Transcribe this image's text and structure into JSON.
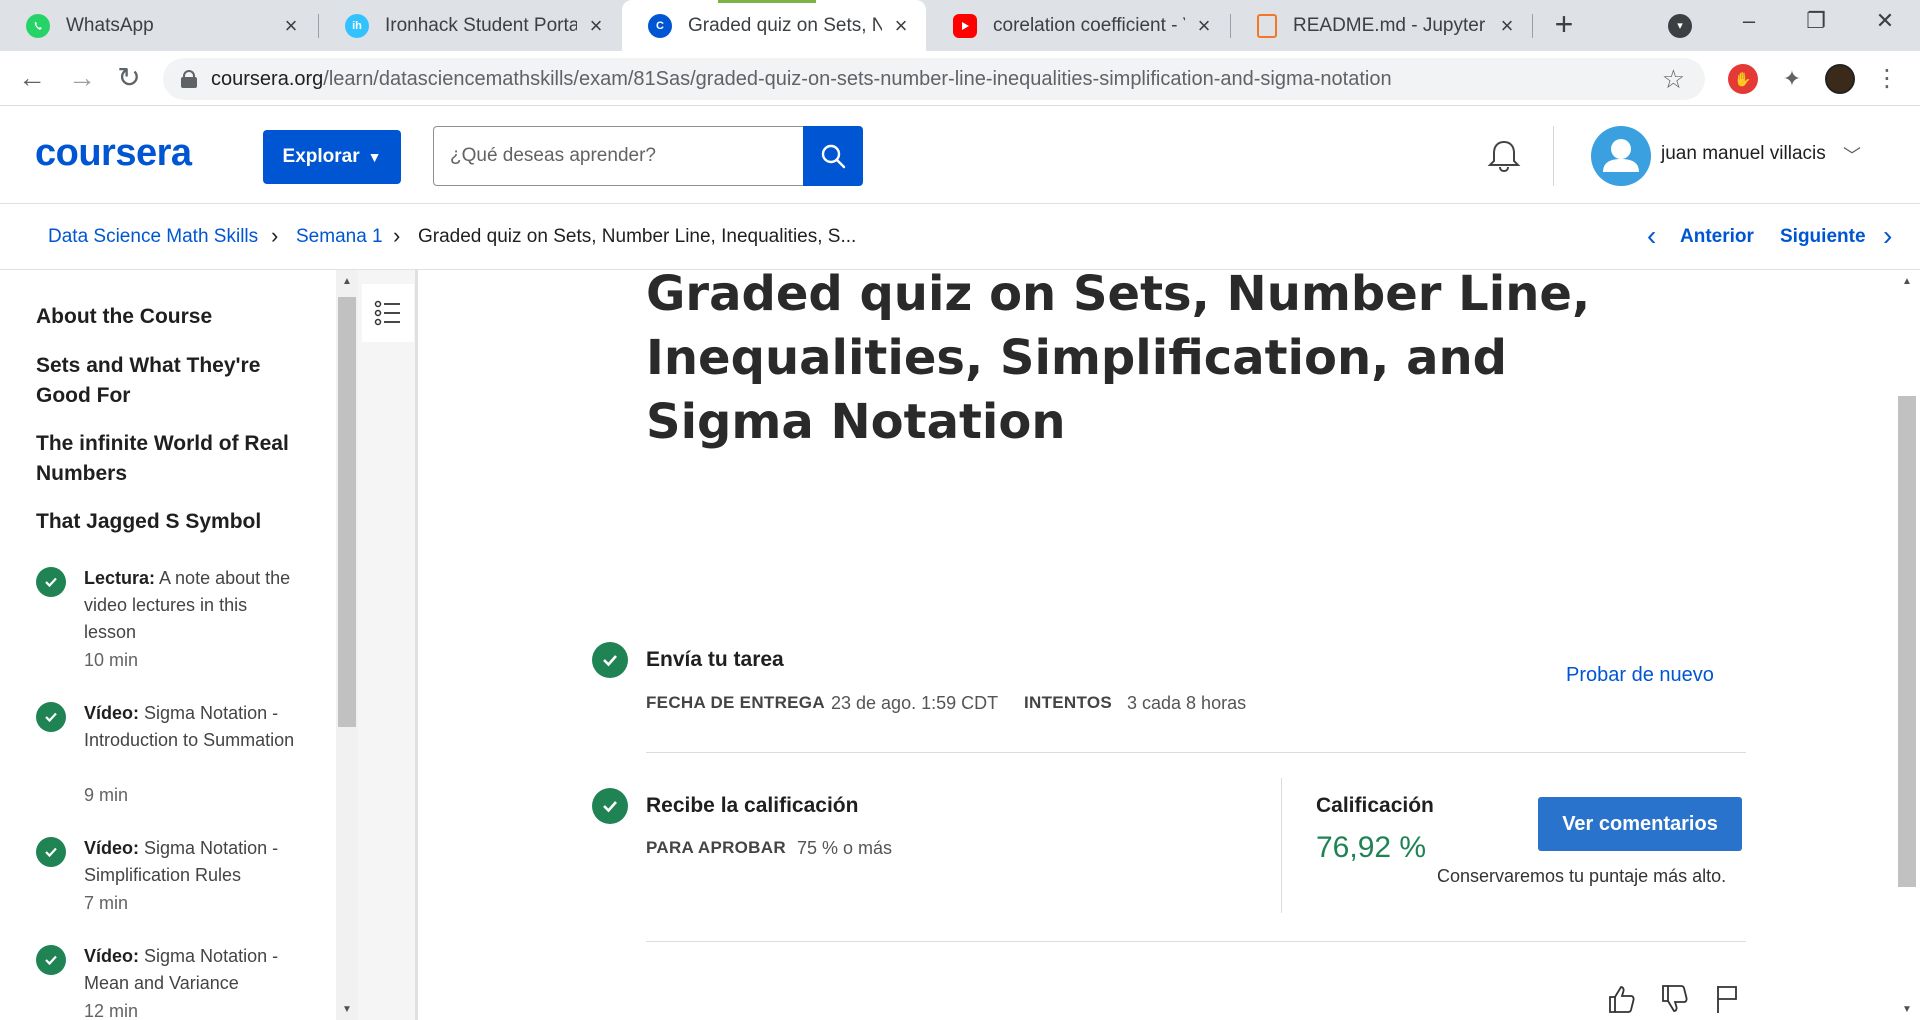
{
  "browser": {
    "tabs": [
      {
        "title": "WhatsApp",
        "icon": "whatsapp-icon",
        "color": "#25d366"
      },
      {
        "title": "Ironhack Student Portal",
        "icon": "ironhack-icon",
        "color": "#32c3ff"
      },
      {
        "title": "Graded quiz on Sets, Num",
        "icon": "coursera-icon",
        "color": "#0056d2"
      },
      {
        "title": "corelation coefficient - You",
        "icon": "youtube-icon",
        "color": "#ff0000"
      },
      {
        "title": "README.md - Jupyter Tex",
        "icon": "file-icon",
        "color": "#f37726"
      }
    ],
    "url_domain": "coursera.org",
    "url_path": "/learn/datasciencemathskills/exam/81Sas/graded-quiz-on-sets-number-line-inequalities-simplification-and-sigma-notation"
  },
  "header": {
    "logo": "coursera",
    "explore_label": "Explorar",
    "search_placeholder": "¿Qué deseas aprender?",
    "user_name": "juan manuel villacis"
  },
  "breadcrumb": {
    "course": "Data Science Math Skills",
    "week": "Semana 1",
    "current": "Graded quiz on Sets, Number Line, Inequalities, S...",
    "prev": "Anterior",
    "next": "Siguiente"
  },
  "sidebar": {
    "headings": [
      "About the Course",
      "Sets and What They're Good For",
      "The infinite World of Real Numbers",
      "That Jagged S Symbol"
    ],
    "items": [
      {
        "kind": "Lectura:",
        "title": "A note about the video lectures in this lesson",
        "duration": "10 min"
      },
      {
        "kind": "Vídeo:",
        "title": "Sigma Notation - Introduction to Summation",
        "duration": "9 min"
      },
      {
        "kind": "Vídeo:",
        "title": "Sigma Notation - Simplification Rules",
        "duration": "7 min"
      },
      {
        "kind": "Vídeo:",
        "title": "Sigma Notation - Mean and Variance",
        "duration": "12 min"
      }
    ]
  },
  "main": {
    "title": "Graded quiz on Sets, Number Line, Inequalities, Simplification, and Sigma Notation",
    "submit": {
      "title": "Envía tu tarea",
      "due_label": "FECHA DE ENTREGA",
      "due_value": "23 de ago. 1:59 CDT",
      "attempts_label": "INTENTOS",
      "attempts_value": "3 cada 8 horas",
      "retry_label": "Probar de nuevo"
    },
    "grade": {
      "title": "Recibe la calificación",
      "pass_label": "PARA APROBAR",
      "pass_value": "75 % o más",
      "grade_label": "Calificación",
      "grade_value": "76,92 %",
      "feedback_button": "Ver comentarios",
      "keep_note": "Conservaremos tu puntaje más alto."
    }
  },
  "colors": {
    "brand": "#0056d2",
    "success": "#1f8354"
  }
}
